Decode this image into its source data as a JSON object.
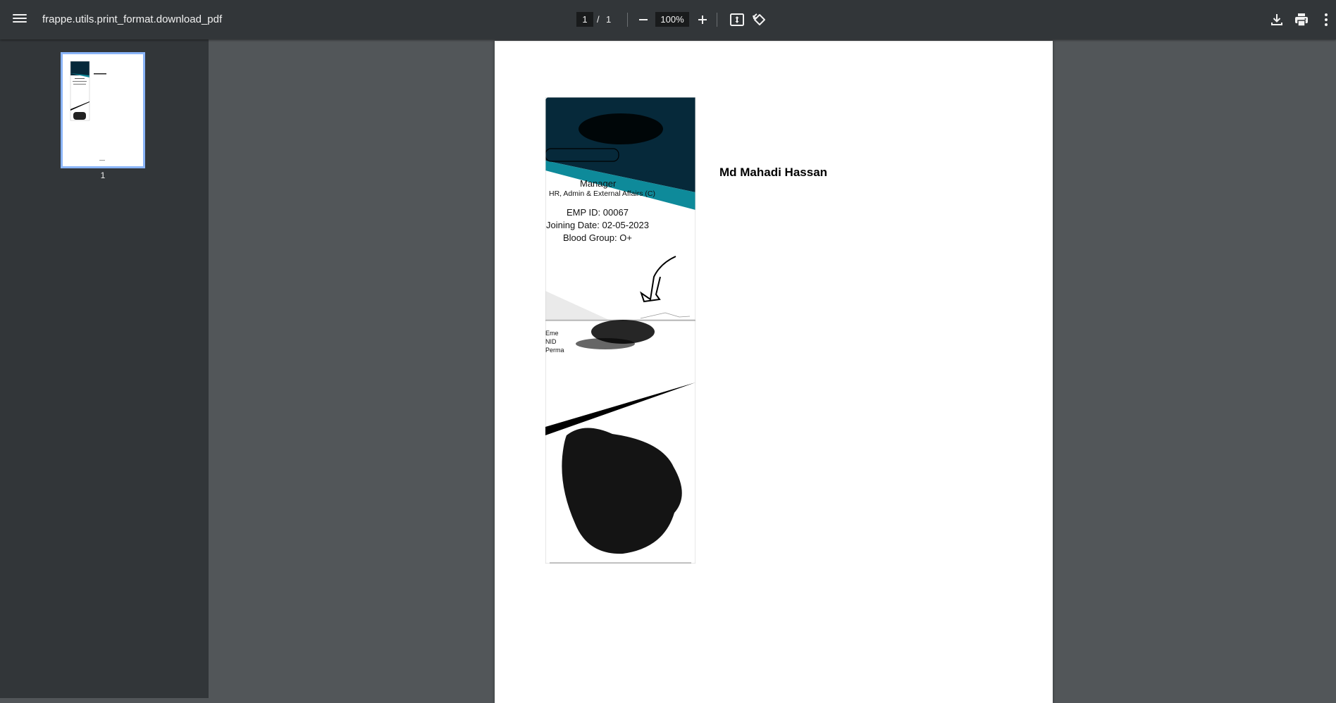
{
  "toolbar": {
    "title": "frappe.utils.print_format.download_pdf",
    "current_page": "1",
    "page_separator": "/",
    "total_pages": "1",
    "zoom": "100%",
    "icons": [
      "menu-icon",
      "zoom-out-icon",
      "zoom-in-icon",
      "fit-to-page-icon",
      "rotate-icon",
      "download-icon",
      "print-icon",
      "more-icon"
    ]
  },
  "sidebar": {
    "thumbnails": [
      {
        "label": "1"
      }
    ]
  },
  "document": {
    "employee_name": "Md Mahadi Hassan",
    "card_front": {
      "designation": "Manager",
      "department": "HR, Admin & External Affairs (C)",
      "emp_id": "EMP ID: 00067",
      "joining_date": "Joining Date: 02-05-2023",
      "blood_group": "Blood Group: O+"
    },
    "card_back": {
      "line1": "Eme",
      "line2": "NID",
      "line3": "Perma"
    }
  },
  "colors": {
    "toolbar_bg": "#323639",
    "viewer_bg": "#525659",
    "card_dark": "#06293a",
    "card_accent": "#0e8a9a",
    "thumb_border": "#8ab4f8"
  }
}
